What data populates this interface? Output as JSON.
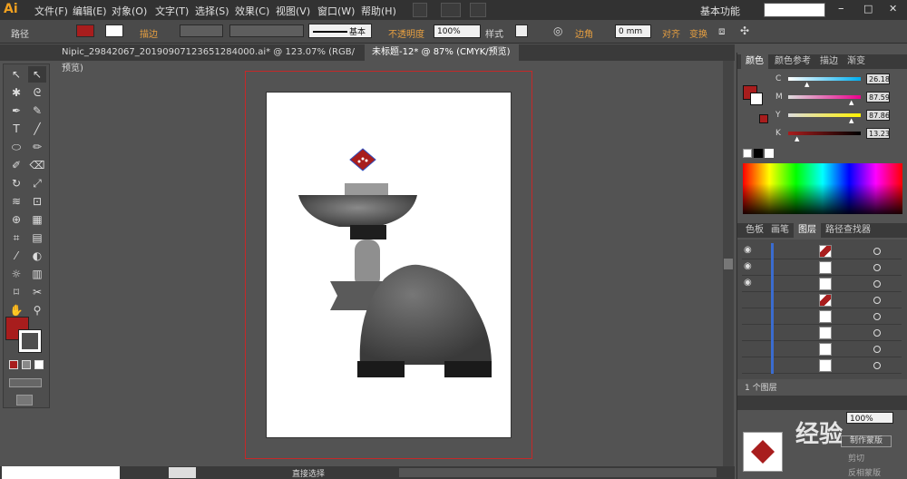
{
  "app": {
    "logo": "Ai"
  },
  "menus": [
    "文件(F)",
    "编辑(E)",
    "对象(O)",
    "文字(T)",
    "选择(S)",
    "效果(C)",
    "视图(V)",
    "窗口(W)",
    "帮助(H)"
  ],
  "workspace": {
    "label": "基本功能"
  },
  "control_bar": {
    "path_label": "路径",
    "stroke_label": "描边",
    "stroke_style": "基本",
    "opacity_label": "不透明度",
    "opacity_value": "100%",
    "style_label": "样式",
    "corner_label": "边角",
    "corner_value": "0 mm",
    "align_label": "对齐",
    "transform_label": "变换"
  },
  "tabs": [
    {
      "label": "Nipic_29842067_20190907123651284000.ai* @ 123.07% (RGB/预览)"
    },
    {
      "label": "未标题-12* @ 87% (CMYK/预览)"
    }
  ],
  "color_panel": {
    "tabs": [
      "颜色",
      "颜色参考",
      "描边",
      "渐变"
    ],
    "channels": [
      {
        "name": "C",
        "value": "26.18",
        "marker": 0.26
      },
      {
        "name": "M",
        "value": "87.59",
        "marker": 0.88
      },
      {
        "name": "Y",
        "value": "87.86",
        "marker": 0.88
      },
      {
        "name": "K",
        "value": "13.23",
        "marker": 0.13
      }
    ],
    "fill_color": "#a81d1d"
  },
  "layers_panel": {
    "tabs": [
      "色板",
      "画笔",
      "图层",
      "路径查找器"
    ],
    "footer": "1 个图层"
  },
  "transparency_panel": {
    "opacity": "100%",
    "make_mask": "制作蒙版",
    "clip": "剪切",
    "invert": "反相蒙版"
  },
  "status": {
    "zoom": "直接选择"
  },
  "watermark": {
    "text": "经验"
  }
}
